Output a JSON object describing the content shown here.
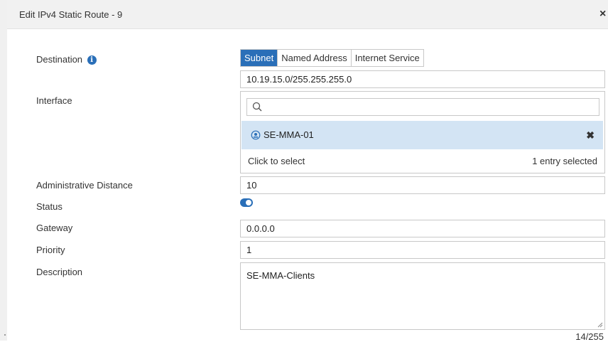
{
  "dialog": {
    "title": "Edit IPv4 Static Route - 9",
    "close_symbol": "×"
  },
  "labels": {
    "destination": "Destination",
    "interface": "Interface",
    "admin_distance": "Administrative Distance",
    "status": "Status",
    "gateway": "Gateway",
    "priority": "Priority",
    "description": "Description"
  },
  "destination": {
    "info_symbol": "i",
    "options": [
      "Subnet",
      "Named Address",
      "Internet Service"
    ],
    "selected": "Subnet",
    "value": "10.19.15.0/255.255.255.0"
  },
  "interface": {
    "search_value": "",
    "entry_name": "SE-MMA-01",
    "remove_symbol": "✖",
    "click_to_select": "Click to select",
    "entries_selected": "1 entry selected"
  },
  "admin_distance": {
    "value": "10"
  },
  "status": {
    "enabled": true
  },
  "gateway": {
    "value": "0.0.0.0"
  },
  "priority": {
    "value": "1"
  },
  "description": {
    "value": "SE-MMA-Clients",
    "counter": "14/255"
  },
  "colors": {
    "accent": "#2a6fb8",
    "selected_entry_bg": "#d3e4f4",
    "header_bg": "#f1f1f1"
  },
  "icons": {
    "search": "search-icon",
    "interface": "interface-icon",
    "info": "info-icon",
    "close": "close-icon",
    "remove": "remove-icon"
  }
}
